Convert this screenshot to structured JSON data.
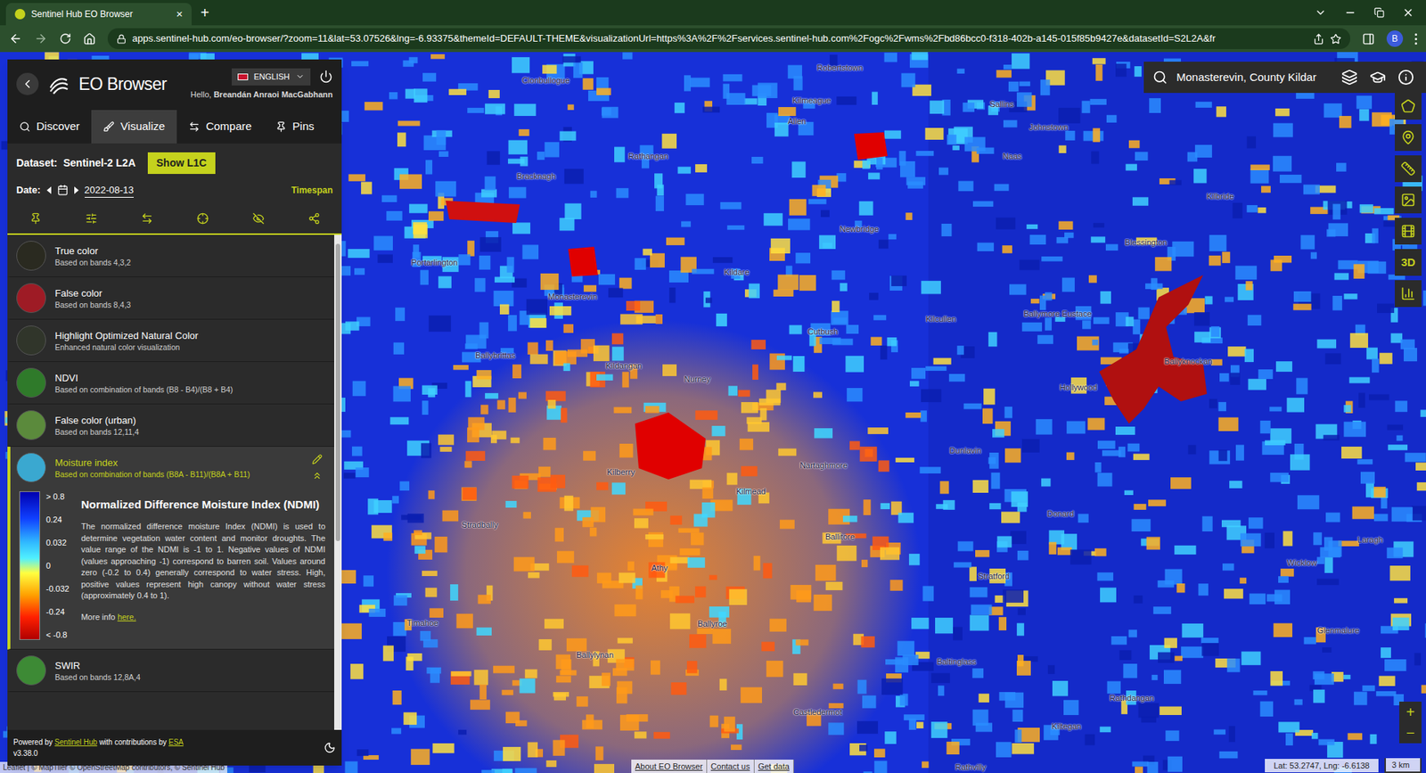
{
  "browser": {
    "tab_title": "Sentinel Hub EO Browser",
    "tab_close": "×",
    "new_tab": "+",
    "url": "apps.sentinel-hub.com/eo-browser/?zoom=11&lat=53.07526&lng=-6.93375&themeId=DEFAULT-THEME&visualizationUrl=https%3A%2F%2Fservices.sentinel-hub.com%2Fogc%2Fwms%2Fbd86bcc0-f318-402b-a145-015f85b9427e&datasetId=S2L2A&fr",
    "profile": "B"
  },
  "sidebar": {
    "logo": "EO Browser",
    "language": "ENGLISH",
    "greeting": "Hello,",
    "user": "Breandán Anraoi MacGabhann",
    "tabs": [
      {
        "label": "Discover",
        "selected": false
      },
      {
        "label": "Visualize",
        "selected": true
      },
      {
        "label": "Compare",
        "selected": false
      },
      {
        "label": "Pins",
        "selected": false
      }
    ],
    "dataset_label": "Dataset:",
    "dataset": "Sentinel-2 L2A",
    "show_button": "Show L1C",
    "date_label": "Date:",
    "date": "2022-08-13",
    "timespan": "Timespan",
    "layers": [
      {
        "name": "True color",
        "description": "Based on bands 4,3,2",
        "selected": false,
        "expanded": false,
        "color": "#2a2a20"
      },
      {
        "name": "False color",
        "description": "Based on bands 8,4,3",
        "selected": false,
        "expanded": false,
        "color": "#9e1b25"
      },
      {
        "name": "Highlight Optimized Natural Color",
        "description": "Enhanced natural color visualization",
        "selected": false,
        "expanded": false,
        "color": "#30352a"
      },
      {
        "name": "NDVI",
        "description": "Based on combination of bands (B8 - B4)/(B8 + B4)",
        "selected": false,
        "expanded": false,
        "color": "#2f7a2a"
      },
      {
        "name": "False color (urban)",
        "description": "Based on bands 12,11,4",
        "selected": false,
        "expanded": false,
        "color": "#5b8a3c"
      },
      {
        "name": "Moisture index",
        "description": "Based on combination of bands (B8A - B11)/(B8A + B11)",
        "selected": true,
        "expanded": true,
        "color": "#3aa8d0"
      },
      {
        "name": "SWIR",
        "description": "Based on bands 12,8A,4",
        "selected": false,
        "expanded": false,
        "color": "#3d8a35"
      }
    ],
    "legend": {
      "labels": [
        "> 0.8",
        "0.24",
        "0.032",
        "0",
        "-0.032",
        "-0.24",
        "< -0.8"
      ],
      "title": "Normalized Difference Moisture Index (NDMI)",
      "description": "The normalized difference moisture Index (NDMI) is used to determine vegetation water content and monitor droughts. The value range of the NDMI is -1 to 1. Negative values of NDMI (values approaching -1) correspond to barren soil. Values around zero (-0.2 to 0.4) generally correspond to water stress. High, positive values represent high canopy without water stress (approximately 0.4 to 1).",
      "more_info": "More info",
      "link": "here."
    },
    "footer": {
      "powered": "Powered by",
      "sentinel": "Sentinel Hub",
      "with": "with contributions by",
      "esa": "ESA",
      "version": "v3.38.0"
    }
  },
  "map": {
    "search": "Monasterevin, County Kildar",
    "tool_3d": "3D",
    "labels": [
      "Clonbullogue",
      "Robertstown",
      "Kilmeague",
      "Allen",
      "Sallins",
      "Johnstown",
      "Rathangan",
      "Bracknagh",
      "Naas",
      "Kilbride",
      "Newbridge",
      "Portarlington",
      "Kildare",
      "Monasterevin",
      "Blessington",
      "Ballymore Eustace",
      "Kilcullen",
      "Cutbush",
      "Ballybrittas",
      "Kildangan",
      "Nurney",
      "Hollywood",
      "Ballyknockan",
      "Kilberry",
      "Nartaghmore",
      "Kilmead",
      "Dunlavin",
      "Stradbally",
      "Donard",
      "Ballitore",
      "Wicklow",
      "Laragh",
      "Timahoe",
      "Athy",
      "Ballyroe",
      "Stratford",
      "Glenmalure",
      "Ballylynan",
      "Baltinglass",
      "Rathdangan",
      "Castledermot",
      "Kiltegan",
      "Rathvilly"
    ],
    "footer_links": [
      "About EO Browser",
      "Contact us",
      "Get data"
    ],
    "coordinates": "Lat: 53.2747, Lng: -6.6138",
    "scale": "3 km",
    "attribution": "Leaflet | © MapTiler © OpenStreetMap contributors, © Sentinel Hub",
    "zoom_in": "+",
    "zoom_out": "−"
  }
}
